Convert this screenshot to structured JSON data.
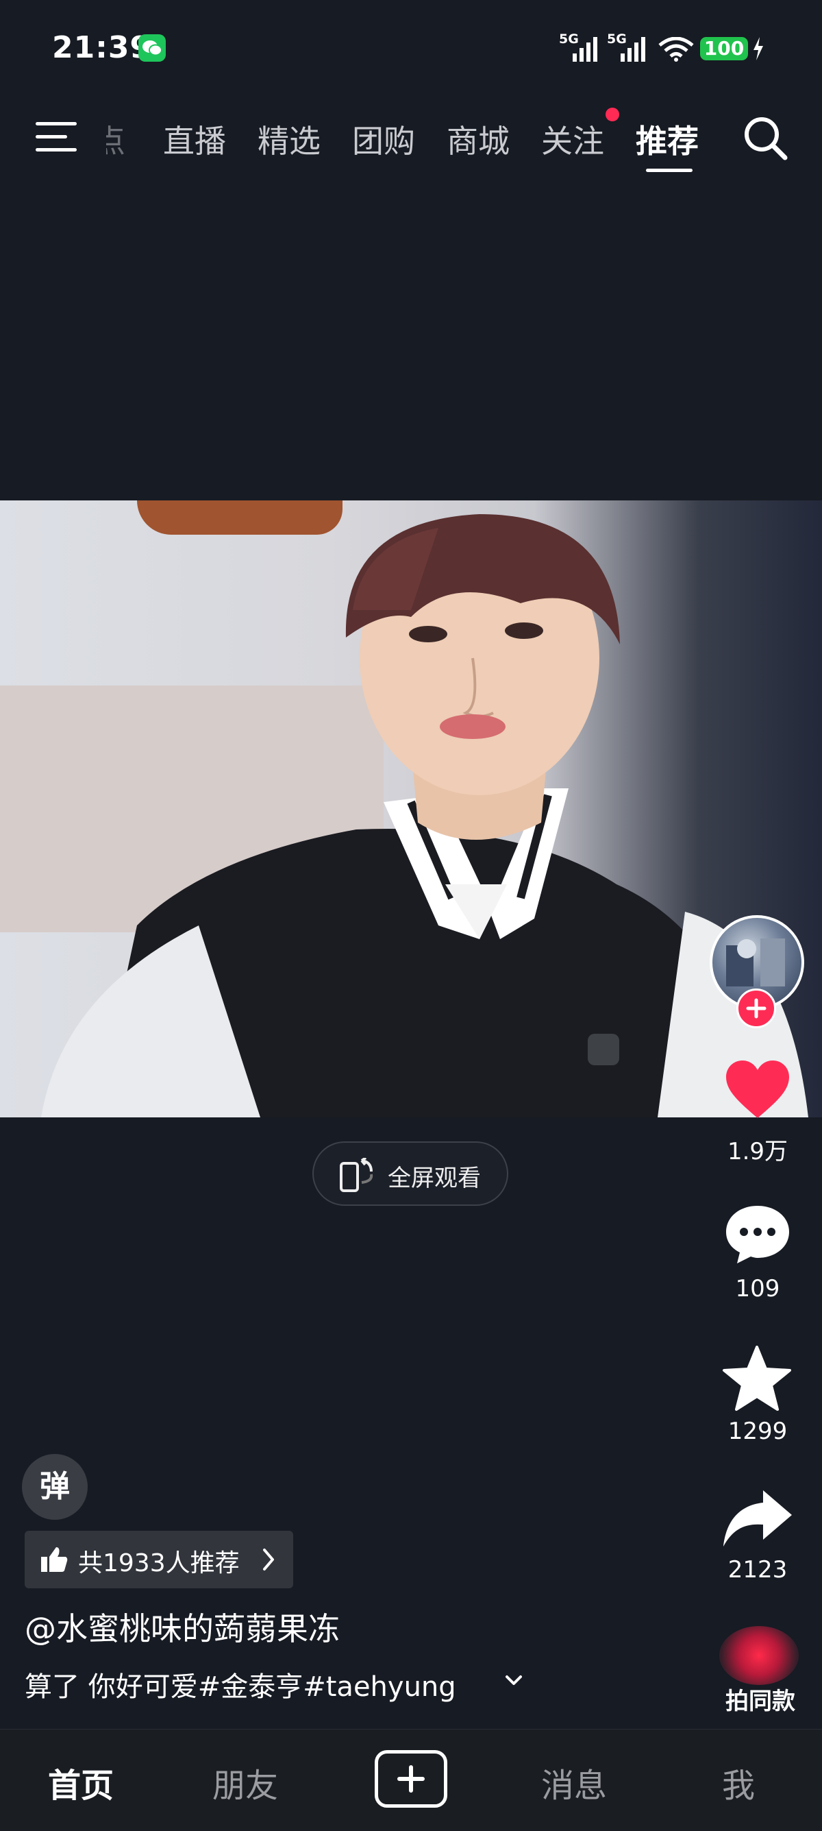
{
  "status_bar": {
    "time": "21:39",
    "network_1": "5G",
    "network_2": "5G",
    "battery": "100"
  },
  "top_nav": {
    "tabs": [
      {
        "label": "点",
        "state": "faded"
      },
      {
        "label": "直播"
      },
      {
        "label": "精选"
      },
      {
        "label": "团购"
      },
      {
        "label": "商城"
      },
      {
        "label": "关注",
        "badge": "dot"
      },
      {
        "label": "推荐",
        "state": "active"
      }
    ],
    "icons": [
      "menu-icon",
      "search-icon"
    ]
  },
  "video": {
    "fullscreen_label": "全屏观看"
  },
  "actions": {
    "likes": "1.9万",
    "comments": "109",
    "favorites": "1299",
    "shares": "2123",
    "same_style_label": "拍同款"
  },
  "post": {
    "danmaku_label": "弹",
    "recommend_label": "共1933人推荐",
    "author": "@水蜜桃味的蒟蒻果冻",
    "caption": "算了 你好可爱#金泰亨#taehyung"
  },
  "bottom_nav": {
    "items": [
      {
        "label": "首页",
        "state": "active"
      },
      {
        "label": "朋友"
      },
      {
        "label": "消息"
      },
      {
        "label": "我"
      }
    ]
  },
  "colors": {
    "background": "#171b23",
    "accent_red": "#fe2c55",
    "battery_green": "#20c34d",
    "wechat_green": "#1ec55b"
  }
}
